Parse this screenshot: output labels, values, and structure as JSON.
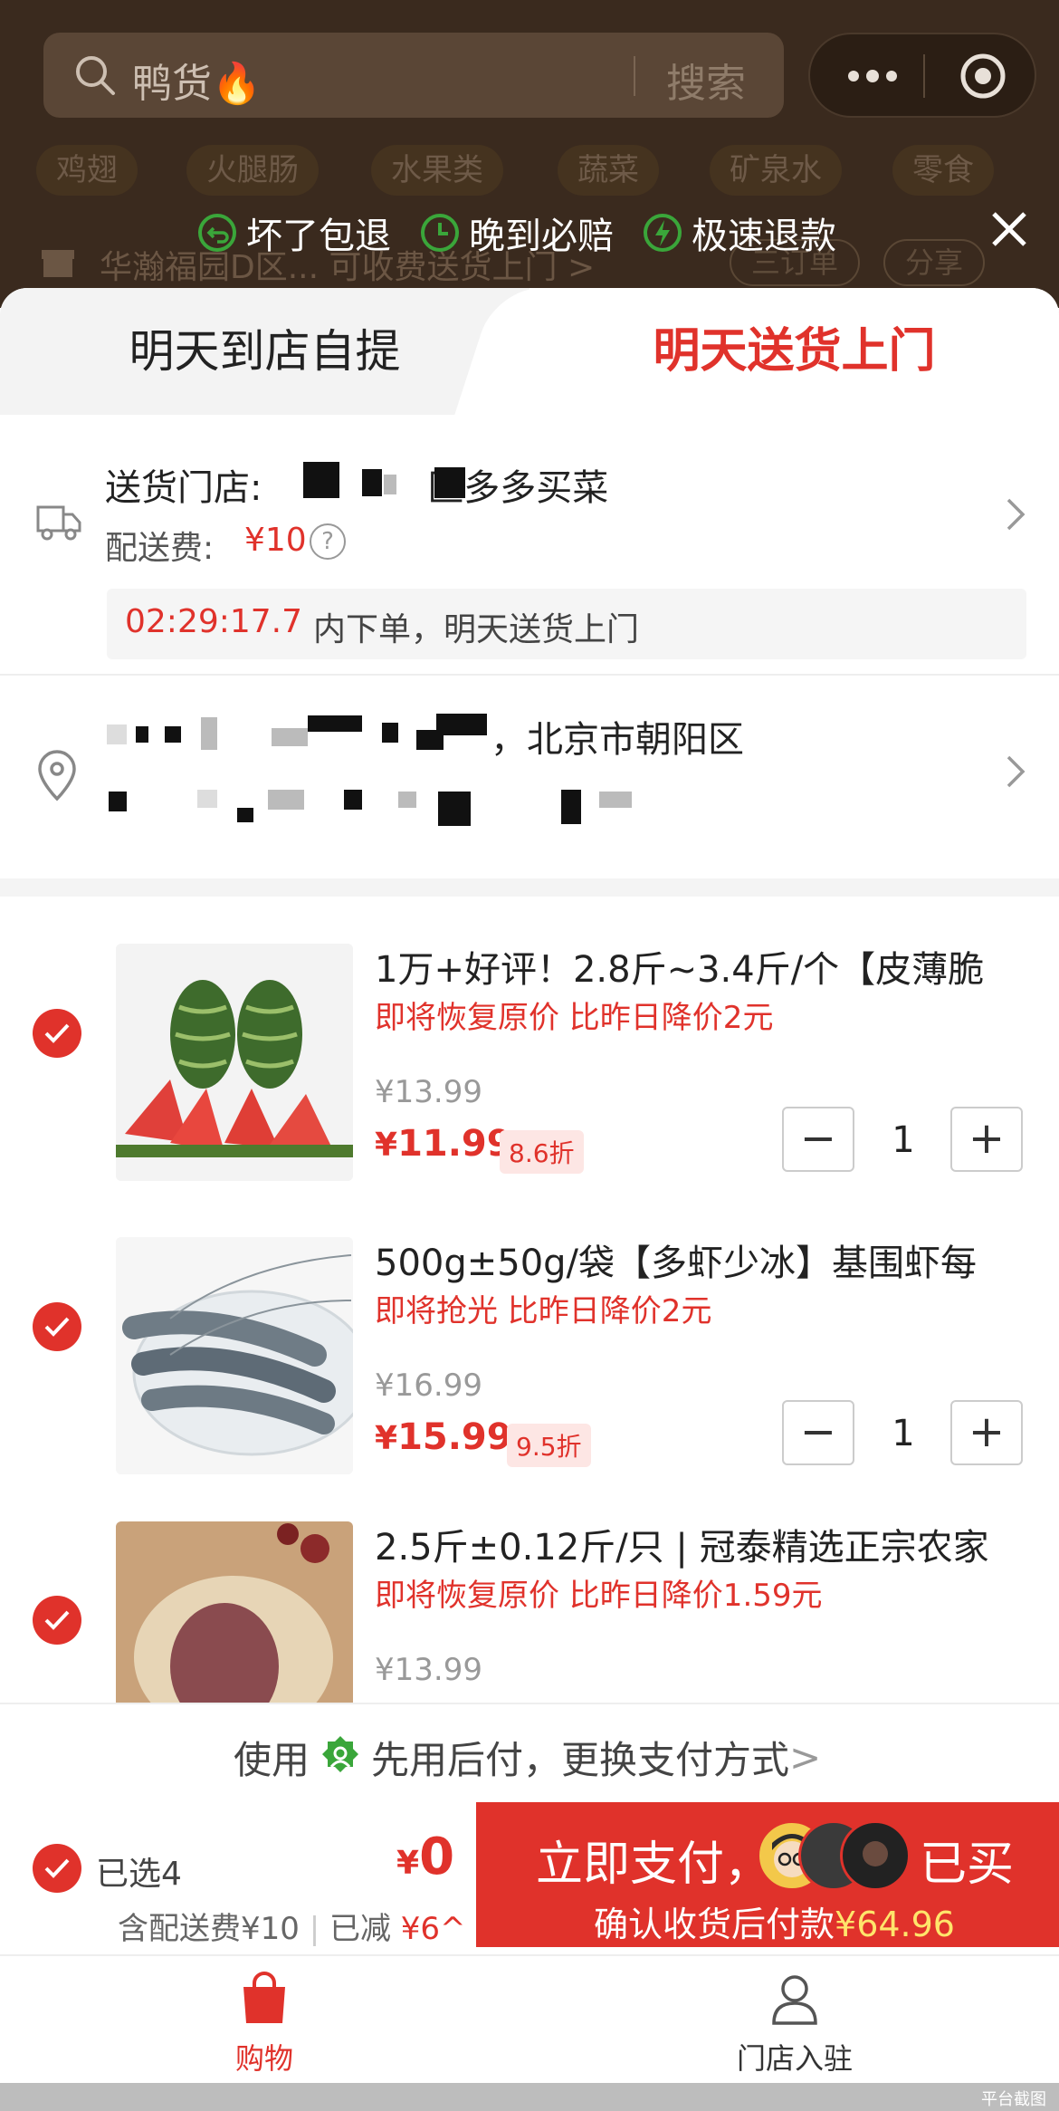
{
  "search": {
    "query": "鸭货🔥",
    "button": "搜索"
  },
  "categories": [
    "鸡翅",
    "火腿肠",
    "水果类",
    "蔬菜",
    "矿泉水",
    "零食"
  ],
  "store_bar": {
    "name": "华瀚福园D区... 可收费送货上门 >",
    "order_btn": "三订单",
    "share_btn": "分享"
  },
  "guarantees": [
    "坏了包退",
    "晚到必赔",
    "极速退款"
  ],
  "tabs": {
    "pickup": "明天到店自提",
    "delivery": "明天送货上门"
  },
  "delivery": {
    "store_label": "送货门店: ",
    "store_suffix": "区多多买菜",
    "fee_label": "配送费:",
    "fee": "¥10",
    "help": "?",
    "countdown": "02:29:17.7",
    "countdown_text": "内下单，明天送货上门"
  },
  "address": {
    "line1_suffix": "，北京市朝阳区"
  },
  "items": [
    {
      "title": "1万+好评！2.8斤~3.4斤/个【皮薄脆",
      "tags": "即将恢复原价  比昨日降价2元",
      "orig": "¥13.99",
      "price_sym": "¥",
      "price": "11.99",
      "discount": "8.6折",
      "qty": "1"
    },
    {
      "title": "500g±50g/袋【多虾少冰】基围虾每",
      "tags": "即将抢光  比昨日降价2元",
      "orig": "¥16.99",
      "price_sym": "¥",
      "price": "15.99",
      "discount": "9.5折",
      "qty": "1"
    },
    {
      "title": "2.5斤±0.12斤/只 | 冠泰精选正宗农家",
      "tags": "即将恢复原价  比昨日降价1.59元",
      "orig": "¥13.99"
    }
  ],
  "stepper": {
    "minus": "−",
    "plus": "+"
  },
  "pay_hint": {
    "pre": "使用",
    "text": "先用后付，更换支付方式",
    "chevron": ">"
  },
  "bottom": {
    "selected": "已选4",
    "total_sym": "¥",
    "total": "0",
    "fee_text": "含配送费¥10",
    "reduced_label": "已减",
    "reduced": "¥6^",
    "pay_main": "立即支付，",
    "bought": "已买",
    "pay_sub_prefix": "确认收货后付款",
    "pay_sub_amount": "¥64.96"
  },
  "tabbar": {
    "shop": "购物",
    "join": "门店入驻"
  },
  "watermark": "平台截图",
  "colors": {
    "accent": "#e0322b",
    "green": "#3aa63a",
    "yellow": "#ffe56b"
  }
}
